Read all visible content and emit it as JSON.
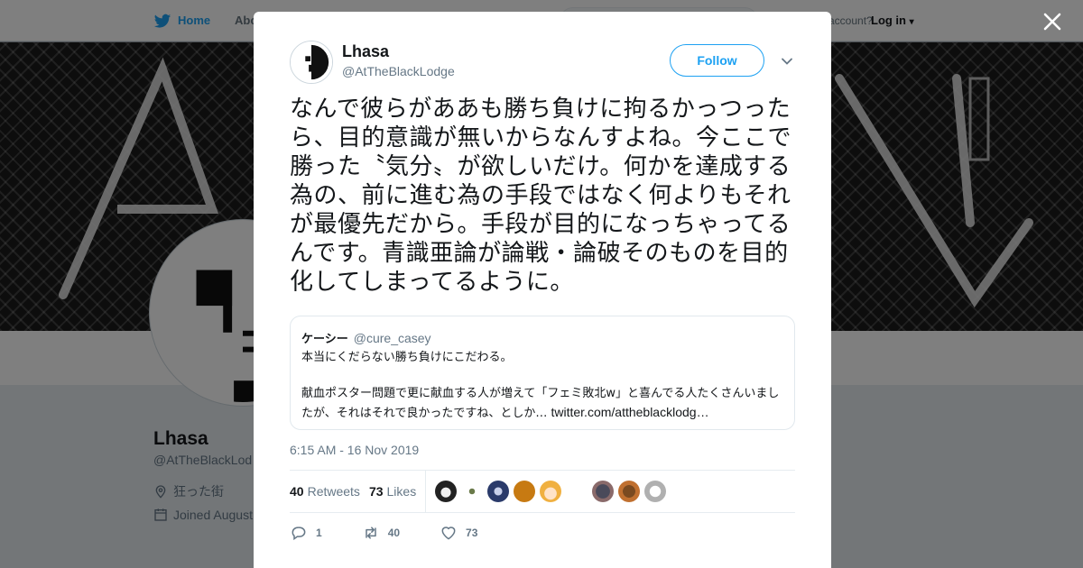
{
  "background": {
    "nav": {
      "home": "Home",
      "about": "Abo",
      "account_prompt": "account?",
      "login": "Log in"
    },
    "profile": {
      "name": "Lhasa",
      "handle": "@AtTheBlackLod",
      "location": "狂った街",
      "joined": "Joined August"
    }
  },
  "tweet": {
    "author_name": "Lhasa",
    "author_handle": "@AtTheBlackLodge",
    "follow_label": "Follow",
    "text": "なんで彼らがああも勝ち負けに拘るかっつったら、目的意識が無いからなんすよね。今ここで勝った〝気分〟が欲しいだけ。何かを達成する為の、前に進む為の手段ではなく何よりもそれが最優先だから。手段が目的になっちゃってるんです。青識亜論が論戦・論破そのものを目的化してしまってるように。",
    "quote": {
      "name": "ケーシー",
      "handle": "@cure_casey",
      "line1": "本当にくだらない勝ち負けにこだわる。",
      "line2": "献血ポスター問題で更に献血する人が増えて「フェミ敗北w」と喜んでる人たくさんいましたが、それはそれで良かったですね、としか… ",
      "link": "twitter.com/attheblacklodg…"
    },
    "timestamp": "6:15 AM - 16 Nov 2019",
    "retweets_count": "40",
    "retweets_label": "Retweets",
    "likes_count": "73",
    "likes_label": "Likes",
    "actions": {
      "replies": "1",
      "retweets": "40",
      "likes": "73"
    }
  },
  "colors": {
    "accent": "#1da1f2",
    "text": "#14171a",
    "secondary": "#657786"
  },
  "icons": [
    "twitter-bird-icon",
    "close-icon",
    "caret-down-icon",
    "reply-icon",
    "retweet-icon",
    "like-icon",
    "location-pin-icon",
    "calendar-icon"
  ]
}
